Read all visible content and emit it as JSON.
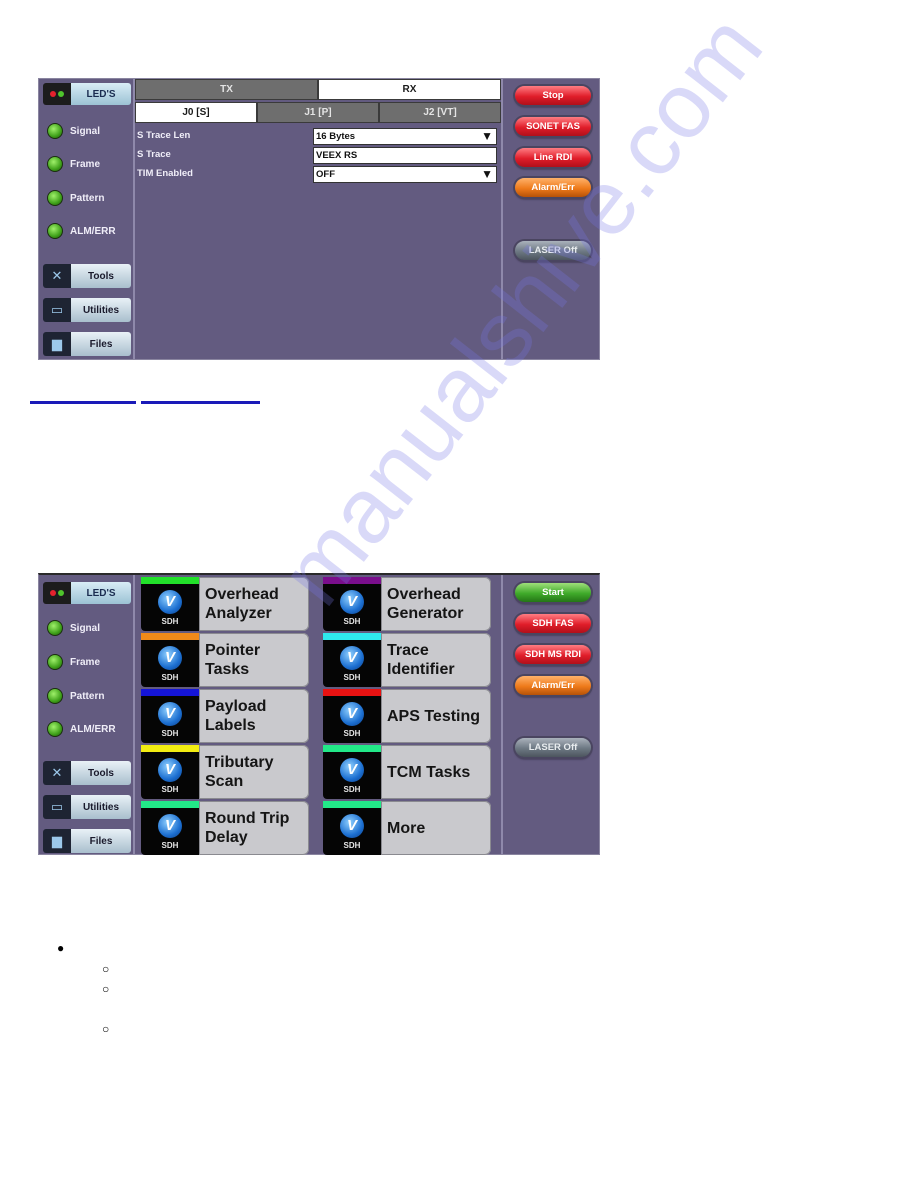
{
  "watermark": "manualshive.com",
  "screen1": {
    "leds_button": "LED'S",
    "leds": [
      {
        "label": "Signal",
        "status": "green"
      },
      {
        "label": "Frame",
        "status": "green"
      },
      {
        "label": "Pattern",
        "status": "green"
      },
      {
        "label": "ALM/ERR",
        "status": "green"
      }
    ],
    "nav": [
      {
        "label": "Tools",
        "icon": "tools-icon"
      },
      {
        "label": "Utilities",
        "icon": "utilities-icon"
      },
      {
        "label": "Files",
        "icon": "files-icon"
      }
    ],
    "main_tabs": [
      {
        "label": "TX",
        "active": false
      },
      {
        "label": "RX",
        "active": true
      }
    ],
    "sub_tabs": [
      {
        "label": "J0 [S]",
        "active": true
      },
      {
        "label": "J1 [P]",
        "active": false
      },
      {
        "label": "J2 [VT]",
        "active": false
      }
    ],
    "fields": [
      {
        "label": "S Trace Len",
        "value": "16 Bytes",
        "type": "dropdown"
      },
      {
        "label": "S Trace",
        "value": "VEEX RS",
        "type": "text"
      },
      {
        "label": "TIM Enabled",
        "value": "OFF",
        "type": "dropdown"
      }
    ],
    "dropdown_arrow": "▼",
    "actions": [
      {
        "label": "Stop",
        "color": "red"
      },
      {
        "label": "SONET FAS",
        "color": "red"
      },
      {
        "label": "Line RDI",
        "color": "red"
      },
      {
        "label": "Alarm/Err",
        "color": "orange"
      },
      {
        "label": "LASER Off",
        "color": "grey"
      }
    ]
  },
  "screen2": {
    "leds_button": "LED'S",
    "leds": [
      {
        "label": "Signal",
        "status": "green"
      },
      {
        "label": "Frame",
        "status": "green"
      },
      {
        "label": "Pattern",
        "status": "green"
      },
      {
        "label": "ALM/ERR",
        "status": "green"
      }
    ],
    "nav": [
      {
        "label": "Tools",
        "icon": "tools-icon"
      },
      {
        "label": "Utilities",
        "icon": "utilities-icon"
      },
      {
        "label": "Files",
        "icon": "files-icon"
      }
    ],
    "tile_icon_text": "SDH",
    "tiles": [
      {
        "label": "Overhead Analyzer",
        "color": "#22e02a"
      },
      {
        "label": "Overhead Generator",
        "color": "#7a0e8c"
      },
      {
        "label": "Pointer Tasks",
        "color": "#f08a1a"
      },
      {
        "label": "Trace Identifier",
        "color": "#2ee8ee"
      },
      {
        "label": "Payload Labels",
        "color": "#1414d8"
      },
      {
        "label": "APS Testing",
        "color": "#e81212"
      },
      {
        "label": "Tributary Scan",
        "color": "#f2ec12"
      },
      {
        "label": "TCM Tasks",
        "color": "#22e888"
      },
      {
        "label": "Round Trip Delay",
        "color": "#22e888"
      },
      {
        "label": "More",
        "color": "#22e888"
      }
    ],
    "actions": [
      {
        "label": "Start",
        "color": "green"
      },
      {
        "label": "SDH FAS",
        "color": "red"
      },
      {
        "label": "SDH MS RDI",
        "color": "red"
      },
      {
        "label": "Alarm/Err",
        "color": "orange"
      },
      {
        "label": "LASER Off",
        "color": "grey"
      }
    ]
  },
  "list_bullets": {
    "level1": "●",
    "level2": "○"
  }
}
